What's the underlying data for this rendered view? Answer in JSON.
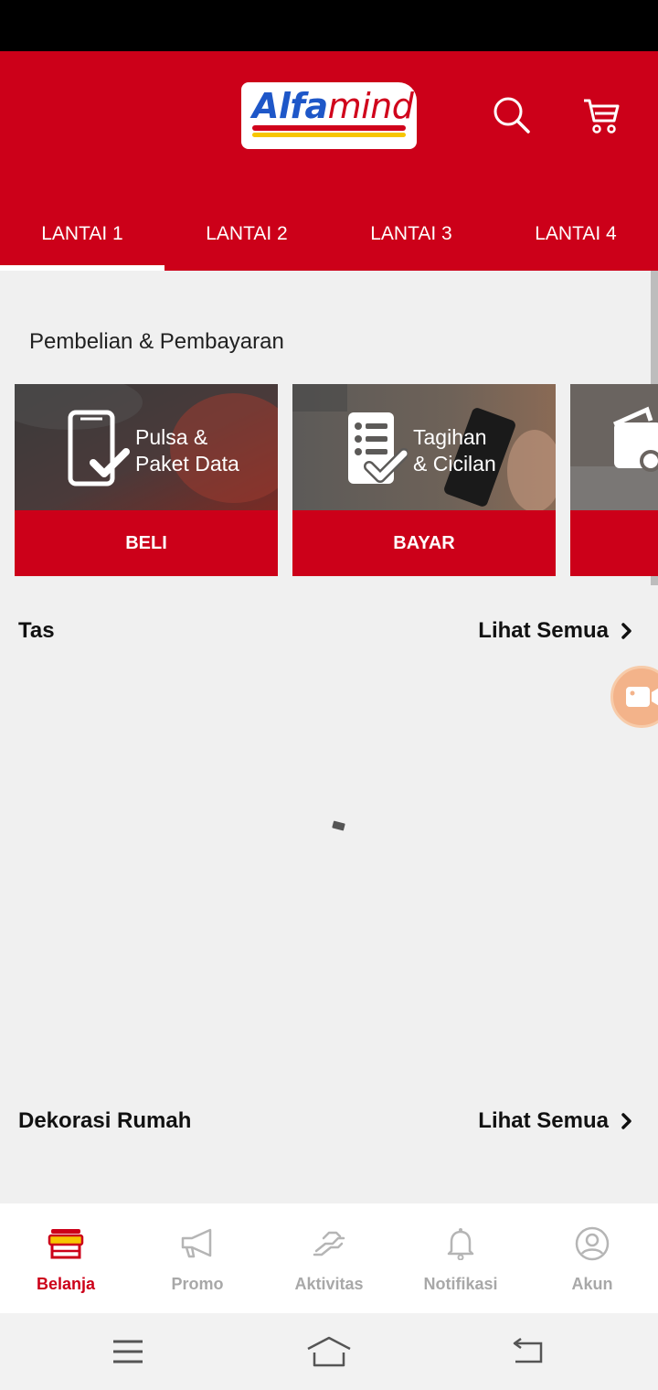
{
  "app": {
    "logo": {
      "part1": "Alfa",
      "part2": "mind"
    },
    "brand_color": "#cc0019",
    "icons": {
      "search": "search-icon",
      "cart": "cart-icon"
    }
  },
  "tabs": [
    {
      "label": "LANTAI 1",
      "active": true
    },
    {
      "label": "LANTAI 2",
      "active": false
    },
    {
      "label": "LANTAI 3",
      "active": false
    },
    {
      "label": "LANTAI 4",
      "active": false
    }
  ],
  "payments": {
    "title": "Pembelian & Pembayaran",
    "cards": [
      {
        "caption_line1": "Pulsa &",
        "caption_line2": "Paket Data",
        "button": "BELI",
        "icon": "phone-check-icon"
      },
      {
        "caption_line1": "Tagihan",
        "caption_line2": "& Cicilan",
        "button": "BAYAR",
        "icon": "bill-check-icon"
      },
      {
        "icon": "wallet-icon"
      }
    ]
  },
  "sections": [
    {
      "title": "Tas",
      "link": "Lihat Semua"
    },
    {
      "title": "Dekorasi Rumah",
      "link": "Lihat Semua"
    }
  ],
  "bottom_nav": [
    {
      "label": "Belanja",
      "icon": "store-icon",
      "active": true
    },
    {
      "label": "Promo",
      "icon": "megaphone-icon",
      "active": false
    },
    {
      "label": "Aktivitas",
      "icon": "handshake-icon",
      "active": false
    },
    {
      "label": "Notifikasi",
      "icon": "bell-icon",
      "active": false
    },
    {
      "label": "Akun",
      "icon": "user-icon",
      "active": false
    }
  ],
  "system_nav": [
    "menu-icon",
    "home-icon",
    "back-icon"
  ]
}
